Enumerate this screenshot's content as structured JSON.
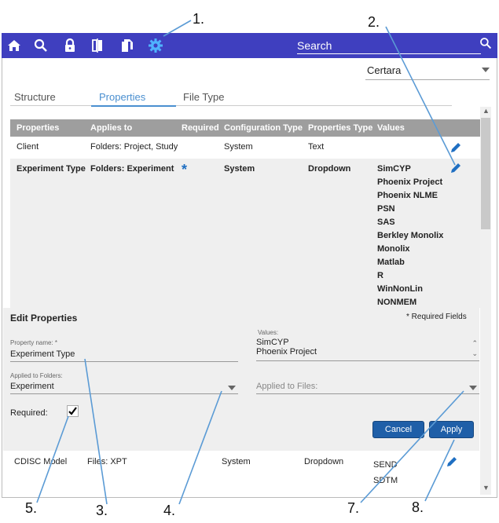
{
  "callouts": [
    "1.",
    "2.",
    "3.",
    "4.",
    "5.",
    "7.",
    "8."
  ],
  "topbar": {
    "search_placeholder": "Search",
    "icons": [
      "home-icon",
      "search-icon",
      "lock-icon",
      "compare-icon",
      "documents-icon",
      "gear-icon"
    ],
    "bg_color": "#3f3fbf",
    "active_icon_color": "#4fb3ff"
  },
  "tenant": {
    "selected": "Certara"
  },
  "tabs": [
    "Structure",
    "Properties",
    "File Type"
  ],
  "table": {
    "headers": [
      "Properties",
      "Applies to",
      "Required",
      "Configuration Type",
      "Properties Type",
      "Values"
    ],
    "rows": [
      {
        "property": "Client",
        "applies_to": "Folders: Project, Study",
        "config_type": "System",
        "prop_type": "Text",
        "values": []
      },
      {
        "property": "Experiment Type",
        "applies_to": "Folders: Experiment",
        "required": "*",
        "config_type": "System",
        "prop_type": "Dropdown",
        "values": [
          "SimCYP",
          "Phoenix Project",
          "Phoenix NLME",
          "PSN",
          "SAS",
          "Berkley Monolix",
          "Monolix",
          "Matlab",
          "R",
          "WinNonLin",
          "NONMEM"
        ]
      },
      {
        "property": "CDISC Model",
        "applies_to": "Files: XPT",
        "config_type": "System",
        "prop_type": "Dropdown",
        "values": [
          "SEND",
          "SDTM"
        ]
      }
    ]
  },
  "edit": {
    "title": "Edit Properties",
    "required_note": "* Required Fields",
    "property_name_label": "Property name: *",
    "property_name_value": "Experiment Type",
    "values_label": "Values:",
    "values_list": [
      "SimCYP",
      "Phoenix Project"
    ],
    "folders_label": "Applied to Folders:",
    "folders_value": "Experiment",
    "files_placeholder": "Applied to Files:",
    "required_label": "Required:",
    "required_checked": true,
    "cancel_label": "Cancel",
    "apply_label": "Apply"
  }
}
